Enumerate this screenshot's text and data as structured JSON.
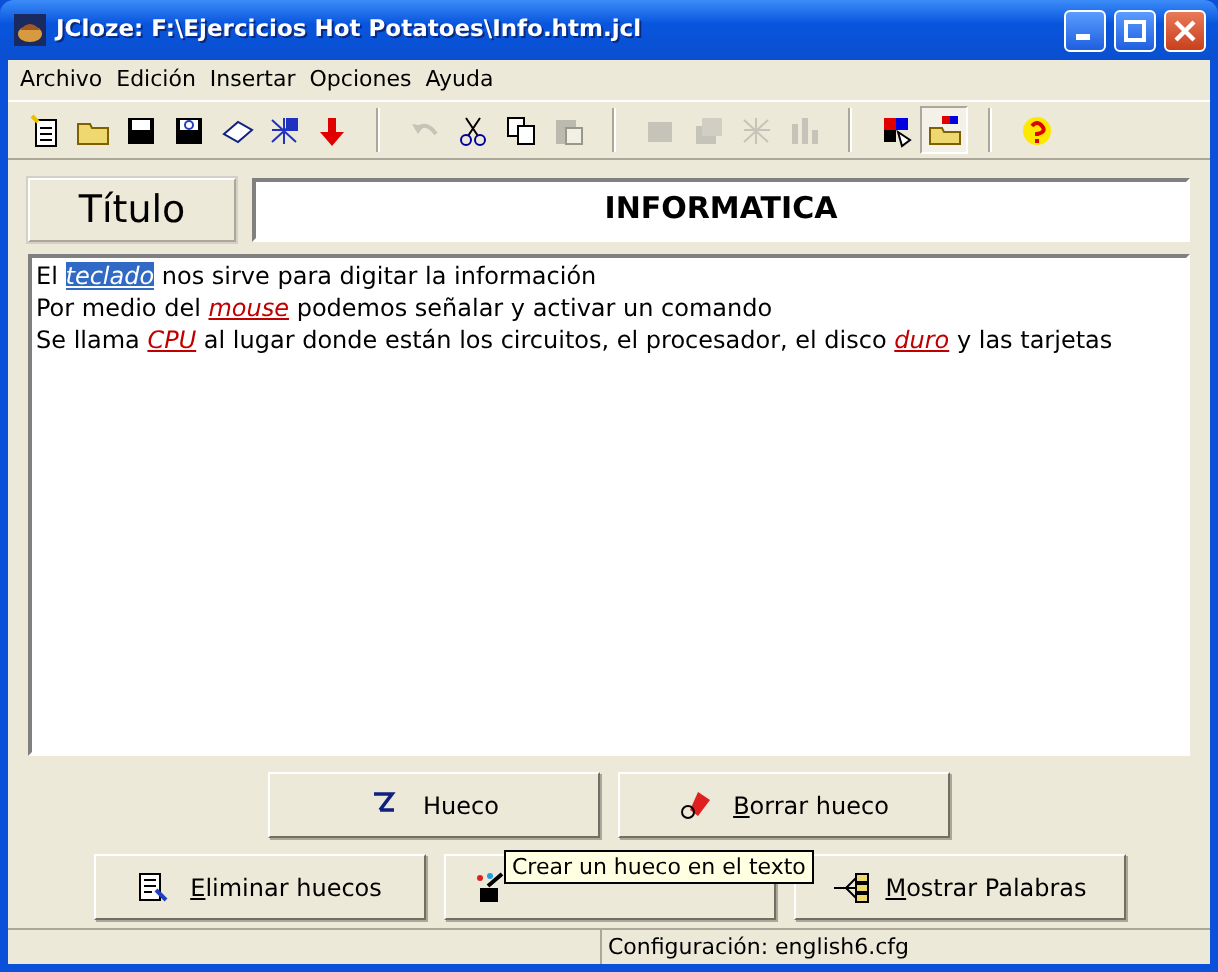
{
  "window": {
    "title": "JCloze: F:\\Ejercicios Hot Potatoes\\Info.htm.jcl"
  },
  "menu": [
    "Archivo",
    "Edición",
    "Insertar",
    "Opciones",
    "Ayuda"
  ],
  "toolbar": [
    [
      {
        "disabled": false,
        "pressed": false
      },
      {
        "disabled": false,
        "pressed": false
      },
      {
        "disabled": false,
        "pressed": false
      },
      {
        "disabled": false,
        "pressed": false
      },
      {
        "disabled": false,
        "pressed": false
      },
      {
        "disabled": false,
        "pressed": false
      },
      {
        "disabled": false,
        "pressed": false
      }
    ],
    [
      {
        "disabled": true,
        "pressed": false
      },
      {
        "disabled": false,
        "pressed": false
      },
      {
        "disabled": false,
        "pressed": false
      },
      {
        "disabled": true,
        "pressed": false
      }
    ],
    [
      {
        "disabled": true,
        "pressed": false
      },
      {
        "disabled": true,
        "pressed": false
      },
      {
        "disabled": true,
        "pressed": false
      },
      {
        "disabled": true,
        "pressed": false
      }
    ],
    [
      {
        "disabled": false,
        "pressed": false
      },
      {
        "disabled": false,
        "pressed": true
      }
    ],
    [
      {
        "disabled": false,
        "pressed": false
      }
    ]
  ],
  "title_label": "Título",
  "title_value": "INFORMATICA",
  "text_lines": [
    [
      {
        "text": "El "
      },
      {
        "text": "teclado",
        "gap": true,
        "selected": true
      },
      {
        "text": " nos sirve para digitar la información"
      }
    ],
    [
      {
        "text": "Por medio del "
      },
      {
        "text": "mouse",
        "gap": true,
        "selected": false
      },
      {
        "text": " podemos señalar y activar un comando"
      }
    ],
    [
      {
        "text": "Se llama "
      },
      {
        "text": "CPU",
        "gap": true,
        "selected": false
      },
      {
        "text": " al lugar donde están los circuitos, el procesador, el disco "
      },
      {
        "text": "duro",
        "gap": true,
        "selected": false
      },
      {
        "text": " y las tarjetas"
      }
    ]
  ],
  "buttons_row1": [
    {
      "label": "Hueco",
      "kind": "gap"
    },
    {
      "label": "**B**orrar hueco",
      "kind": "erase"
    }
  ],
  "buttons_row2": [
    {
      "label": "**E**liminar huecos",
      "kind": "remove"
    },
    {
      "kind": "auto"
    },
    {
      "label": "**M**ostrar Palabras",
      "kind": "tree"
    }
  ],
  "tooltip": "Crear un hueco en el texto",
  "status_bar": {
    "configuration": "Configuración: english6.cfg"
  }
}
